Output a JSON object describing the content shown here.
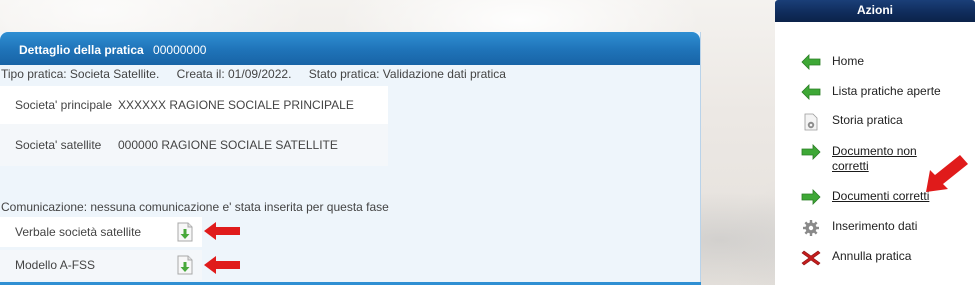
{
  "panel": {
    "title": "Dettaglio della pratica",
    "number": "00000000",
    "info": {
      "tipo": "Tipo pratica: Societa Satellite.",
      "creata": "Creata il: 01/09/2022.",
      "stato": "Stato pratica: Validazione dati pratica"
    },
    "rows": [
      {
        "label": "Societa' principale",
        "value": "XXXXXX RAGIONE SOCIALE PRINCIPALE"
      },
      {
        "label": "Societa' satellite",
        "value": "000000 RAGIONE SOCIALE SATELLITE"
      }
    ],
    "communication": "Comunicazione: nessuna comunicazione e' stata inserita per questa fase",
    "documents": [
      {
        "label": "Verbale società satellite",
        "icon": "download-document-icon"
      },
      {
        "label": "Modello A-FSS",
        "icon": "download-document-icon"
      }
    ]
  },
  "sidebar": {
    "title": "Azioni",
    "items": [
      {
        "label": "Home",
        "icon": "green-arrow-left-icon",
        "link": false
      },
      {
        "label": "Lista pratiche aperte",
        "icon": "green-arrow-left-icon",
        "link": false
      },
      {
        "label": "Storia pratica",
        "icon": "document-gear-icon",
        "link": false
      },
      {
        "label": "Documento non corretti",
        "icon": "green-arrow-right-icon",
        "link": true
      },
      {
        "label": "Documenti corretti",
        "icon": "green-arrow-right-icon",
        "link": true
      },
      {
        "label": "Inserimento dati",
        "icon": "gear-icon",
        "link": false
      },
      {
        "label": "Annulla pratica",
        "icon": "red-x-icon",
        "link": false
      }
    ]
  },
  "colors": {
    "header_blue": "#1f73b8",
    "sidebar_header": "#0f2b5a",
    "annotation_red": "#e01b1b",
    "action_green": "#3ea836"
  }
}
